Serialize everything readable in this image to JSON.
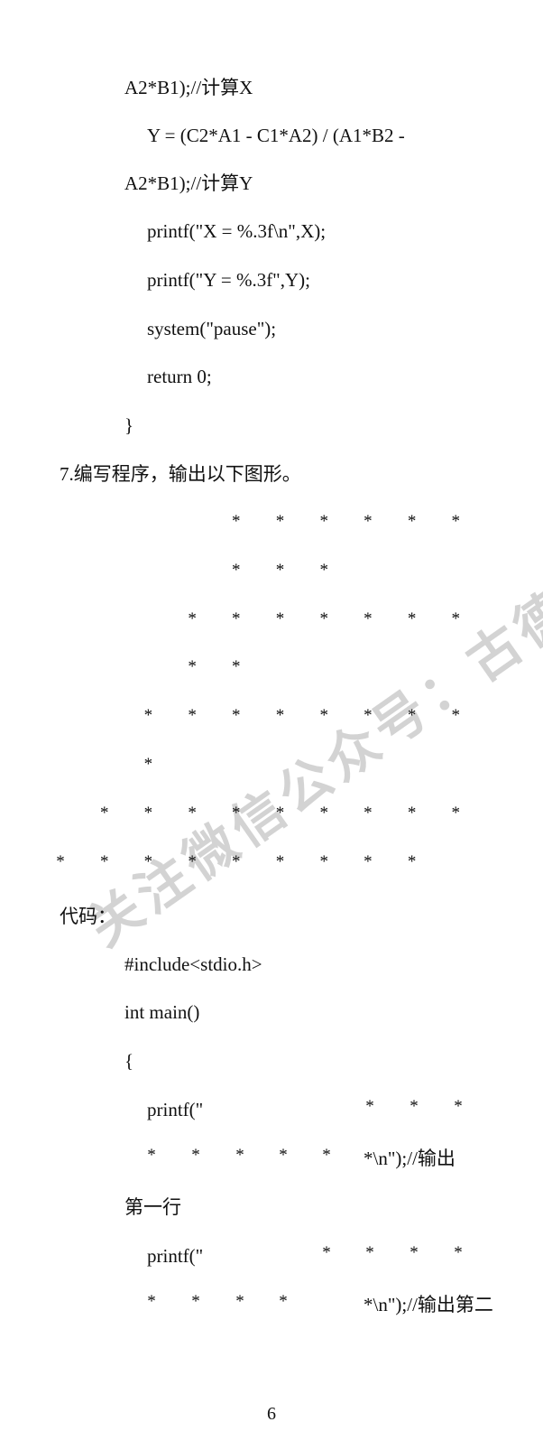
{
  "code_top": [
    "A2*B1);//计算X",
    "Y = (C2*A1 - C1*A2) / (A1*B2 -",
    "A2*B1);//计算Y",
    "printf(\"X = %.3f\\n\",X);",
    "printf(\"Y = %.3f\",Y);",
    "system(\"pause\");",
    "return 0;",
    "}"
  ],
  "question": "7.编写程序，输出以下图形。",
  "star_glyph": "*",
  "pattern_rows": [
    {
      "offset": 4,
      "count": 6
    },
    {
      "offset": 4,
      "count": 3
    },
    {
      "offset": 3,
      "count": 7
    },
    {
      "offset": 3,
      "count": 2
    },
    {
      "offset": 2,
      "count": 8
    },
    {
      "offset": 2,
      "count": 1
    },
    {
      "offset": 1,
      "count": 9
    },
    {
      "offset": 0,
      "count": 9
    }
  ],
  "code_label": "代码：",
  "code_bottom": {
    "include": "#include<stdio.h>",
    "main": "int main()",
    "brace_open": "{",
    "printf1": "printf(\"",
    "row1_end": "*\\n\");//输出",
    "row1_comment_cont": "第一行",
    "printf2": "printf(\"",
    "row2_end": "*\\n\");//输出第二"
  },
  "watermark": "关注微信公众号：古德校园",
  "page_number": "6"
}
